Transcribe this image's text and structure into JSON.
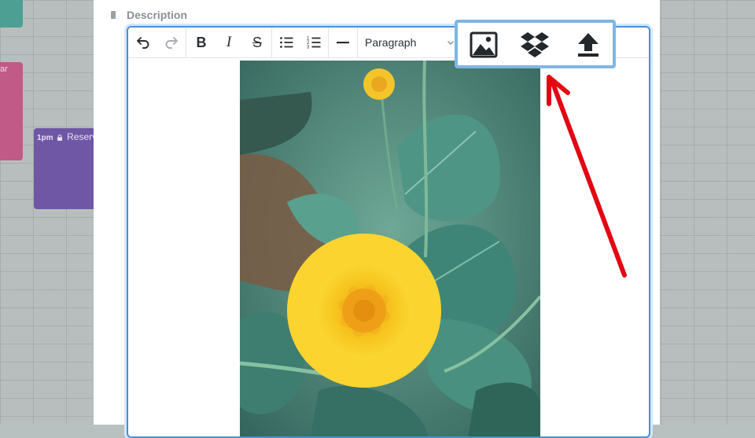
{
  "background": {
    "events": [
      {
        "label": "ar"
      },
      {
        "time": "1pm",
        "title": "Reserv"
      }
    ]
  },
  "modal": {
    "field_label": "Description",
    "toolbar": {
      "undo_icon": "undo-icon",
      "redo_icon": "redo-icon",
      "bold_label": "B",
      "italic_label": "I",
      "strike_label": "S",
      "bullet_list_icon": "bullet-list-icon",
      "numbered_list_icon": "numbered-list-icon",
      "hr_icon": "horizontal-rule-icon",
      "block_format_value": "Paragraph"
    },
    "upload_toolbar": {
      "buttons": [
        "image-icon",
        "dropbox-icon",
        "upload-icon"
      ]
    },
    "content_image": "yellow-flower-photo"
  },
  "annotation": {
    "arrow_color": "#e30613",
    "highlight_color": "#7fb6e3"
  }
}
